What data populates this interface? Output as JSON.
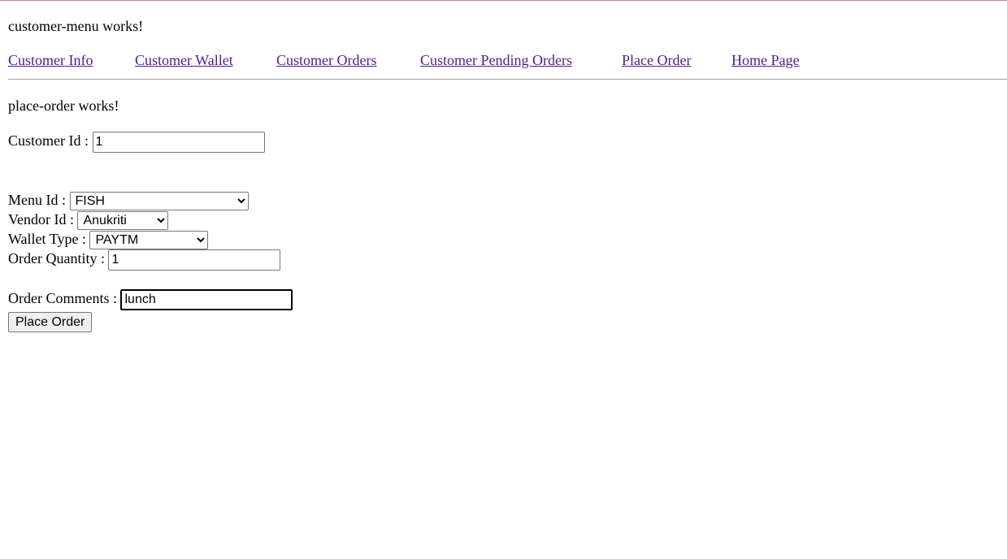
{
  "colors": {
    "top_border": "#d77aa0",
    "link": "#551a8b",
    "divider": "#a0a0a0"
  },
  "menu_title": "customer-menu works!",
  "nav": [
    "Customer Info",
    "Customer Wallet",
    "Customer Orders",
    "Customer Pending Orders",
    "Place Order",
    "Home Page"
  ],
  "page_title": "place-order works!",
  "form": {
    "customer_id_label": "Customer Id :",
    "customer_id": "1",
    "menu_id_label": "Menu Id :",
    "menu_id": "FISH",
    "vendor_id_label": "Vendor Id :",
    "vendor_id": "Anukriti",
    "wallet_type_label": "Wallet Type :",
    "wallet_type": "PAYTM",
    "quantity_label": "Order Quantity :",
    "quantity": "1",
    "comments_label": "Order Comments :",
    "comments": "lunch",
    "submit": "Place Order"
  }
}
